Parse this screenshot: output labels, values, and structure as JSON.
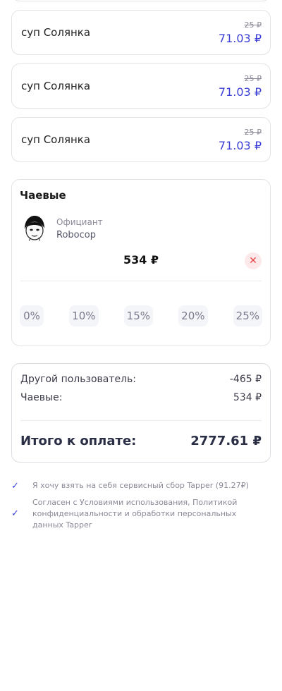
{
  "order_items": [
    {
      "name": "суп Солянка",
      "old_price": "25 ₽",
      "price": "71.03 ₽"
    },
    {
      "name": "суп Солянка",
      "old_price": "25 ₽",
      "price": "71.03 ₽"
    },
    {
      "name": "суп Солянка",
      "old_price": "25 ₽",
      "price": "71.03 ₽"
    }
  ],
  "tips": {
    "title": "Чаевые",
    "waiter_role": "Официант",
    "waiter_name": "Robocop",
    "amount": "534 ₽",
    "clear_icon": "close-icon",
    "percentages": [
      "0%",
      "10%",
      "15%",
      "20%",
      "25%"
    ]
  },
  "summary": {
    "other_user_label": "Другой пользователь:",
    "other_user_value": "-465 ₽",
    "tips_label": "Чаевые:",
    "tips_value": "534 ₽",
    "total_label": "Итого к оплате:",
    "total_value": "2777.61 ₽"
  },
  "consents": {
    "service_fee": "Я хочу взять на себя сервисный сбор Tapper (91.27₽)",
    "terms": "Согласен с Условиями использования, Политикой конфиденциальности и обработки персональных данных Tapper",
    "checked_icon": "checkmark-icon"
  },
  "colors": {
    "accent": "#3b3fd6",
    "danger": "#e84545",
    "border": "#e3e3e8"
  }
}
